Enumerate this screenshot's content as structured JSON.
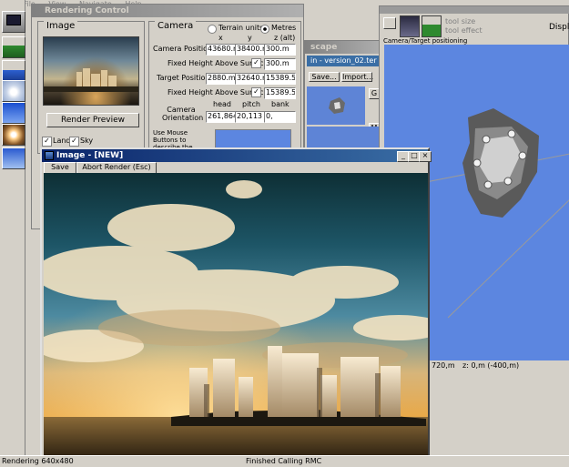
{
  "menu": [
    "World File",
    "View",
    "Navigate",
    "Help"
  ],
  "rendering_control": {
    "title": "Rendering Control",
    "image_group": "Image",
    "render_preview": "Render Preview",
    "checks": [
      {
        "label": "Land",
        "checked": true
      },
      {
        "label": "Sky",
        "checked": true
      }
    ],
    "camera_group": "Camera",
    "terrain_units": "Terrain units",
    "metres": "Metres",
    "col_x": "x",
    "col_y": "y",
    "col_z": "z (alt)",
    "camera_position_label": "Camera Position",
    "camera_position": [
      "43680.m",
      "38400.m",
      "300.m"
    ],
    "fixed_height_label": "Fixed Height Above Surface",
    "fixed_height_camera": "300.m",
    "target_position_label": "Target Position",
    "target_position": [
      "2880.m",
      "32640.m",
      "15389.5"
    ],
    "fixed_height_target": "15389.5",
    "orientation_label": "Camera Orientation",
    "col_head": "head",
    "col_pitch": "pitch",
    "col_bank": "bank",
    "orientation": [
      "261,864",
      "20,113",
      "0,"
    ],
    "hint": "Use Mouse Buttons to describe the camera's view"
  },
  "landscape": {
    "title": "scape",
    "file": "in - version_02.ter",
    "buttons": [
      "Save...",
      "Import..."
    ],
    "side": [
      "G",
      "M"
    ]
  },
  "camera_target": {
    "title_label": "Camera/Target positioning",
    "tool_size": "tool size",
    "tool_effect": "tool effect",
    "display": "Display",
    "coords": "720,m",
    "z": "z: 0,m (-400,m)"
  },
  "image_window": {
    "title": "Image - [NEW]",
    "save": "Save",
    "abort": "Abort Render (Esc)",
    "controls": [
      "_",
      "□",
      "×"
    ]
  },
  "status": {
    "left": "Rendering 640x480",
    "right": "Finished Calling RMC"
  },
  "colors": {
    "title_active": "#0a246a",
    "map_water": "#5c86e0",
    "desktop": "#d4d0c8"
  }
}
